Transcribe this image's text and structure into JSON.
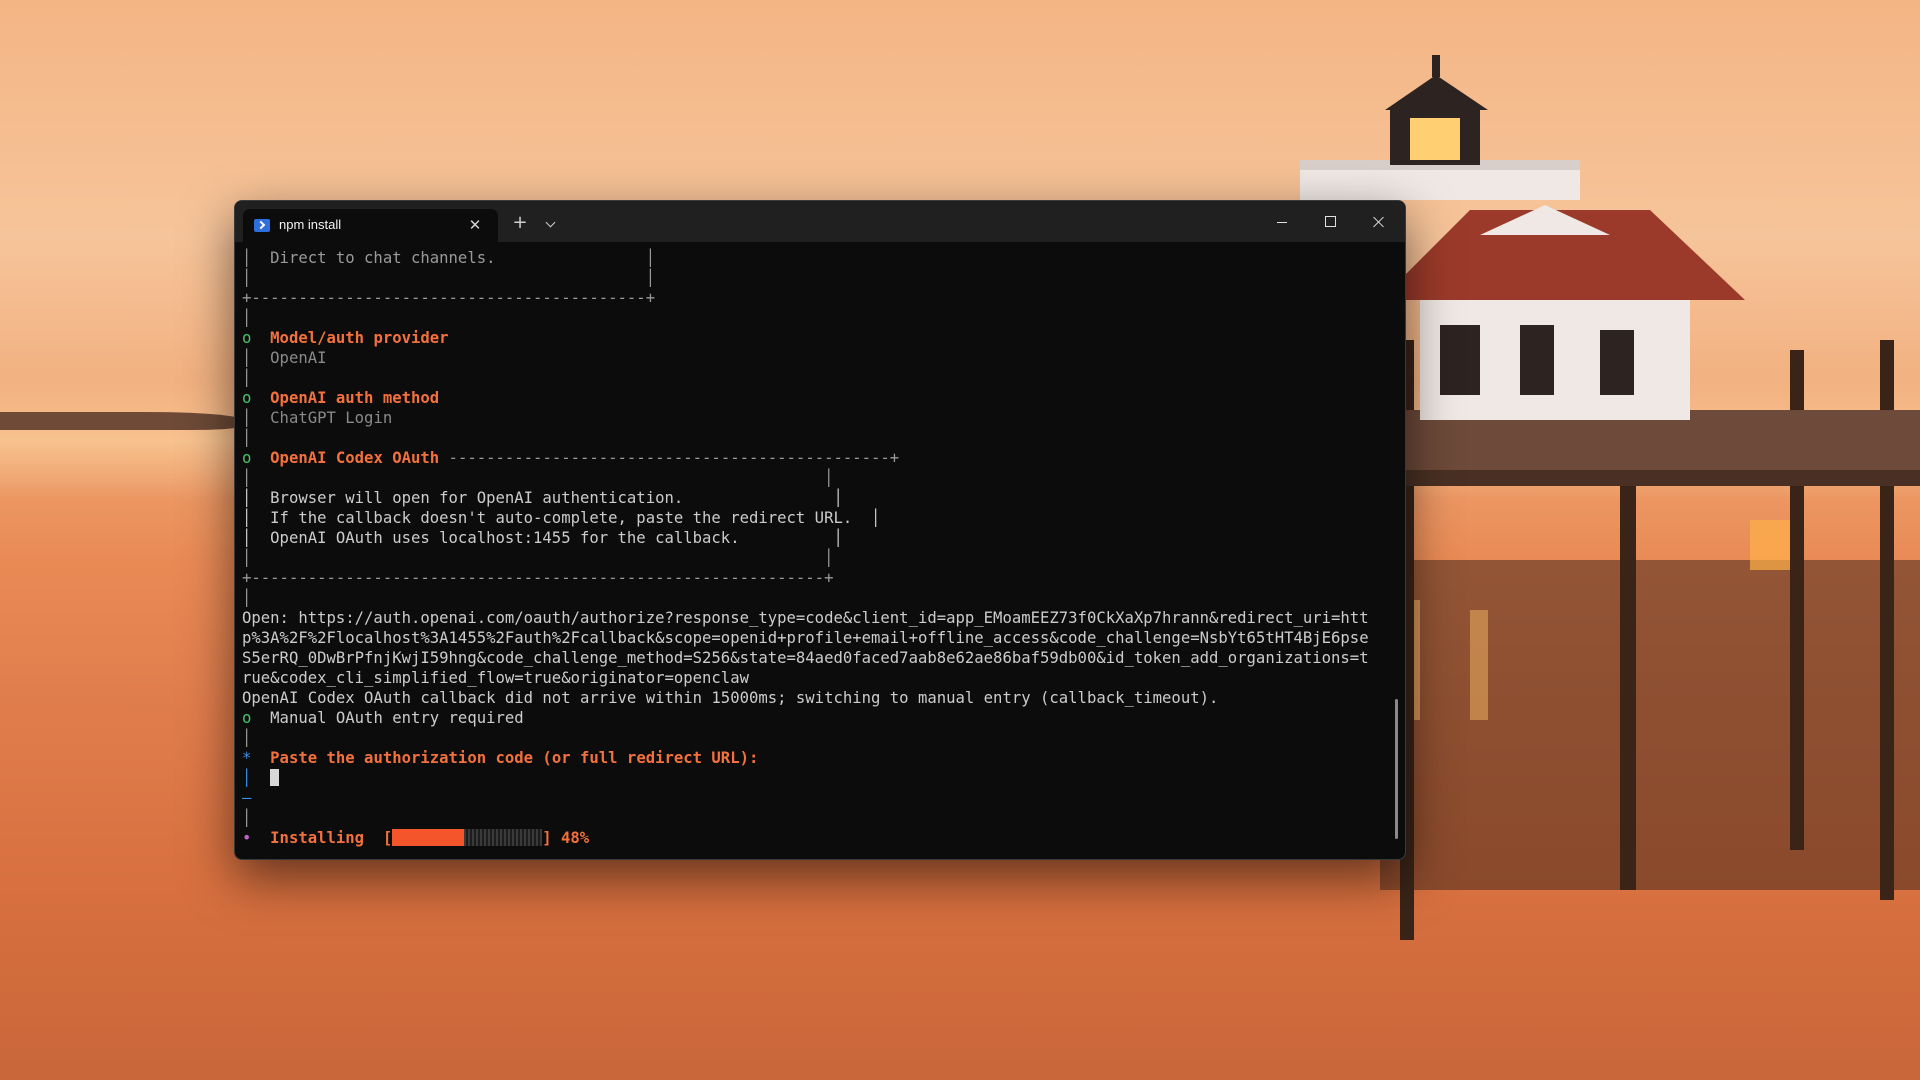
{
  "tab": {
    "title": "npm install",
    "icon": "powershell-icon"
  },
  "titlebar": {
    "new_tab": "+",
    "close_tab": "✕"
  },
  "lines": [
    "│  Direct to chat channels.                │",
    "│                                          │",
    "+------------------------------------------+",
    "│",
    "Model/auth provider",
    "OpenAI",
    "│",
    "OpenAI auth method",
    "ChatGPT Login",
    "│",
    "OpenAI Codex OAuth",
    " -----------------------------------------------+",
    "│                                                             │",
    "│  Browser will open for OpenAI authentication.                │",
    "│  If the callback doesn't auto-complete, paste the redirect URL.  │",
    "│  OpenAI OAuth uses localhost:1455 for the callback.          │",
    "│                                                             │",
    "+-------------------------------------------------------------+",
    "│",
    "Open: https://auth.openai.com/oauth/authorize?response_type=code&client_id=app_EMoamEEZ73f0CkXaXp7hrann&redirect_uri=htt",
    "p%3A%2F%2Flocalhost%3A1455%2Fauth%2Fcallback&scope=openid+profile+email+offline_access&code_challenge=NsbYt65tHT4BjE6pse",
    "S5erRQ_0DwBrPfnjKwjI59hng&code_challenge_method=S256&state=84aed0faced7aab8e62ae86baf59db00&id_token_add_organizations=t",
    "rue&codex_cli_simplified_flow=true&originator=openclaw",
    "OpenAI Codex OAuth callback did not arrive within 15000ms; switching to manual entry (callback_timeout).",
    "Manual OAuth entry required",
    "│",
    "Paste the authorization code (or full redirect URL):",
    "│",
    "—",
    "│",
    "Installing"
  ],
  "markers": {
    "done": "o",
    "active": "*",
    "bar": "│",
    "pipe_blue": "│",
    "dash_blue": "—",
    "spinner": "•"
  },
  "progress": {
    "percent": 48,
    "label": "48%",
    "open_bracket": "[",
    "close_bracket": "]"
  },
  "colors": {
    "success_marker": "#4ac26b",
    "heading_orange": "#f4703c",
    "prompt_blue": "#3b8eea",
    "spinner_purple": "#c061cb",
    "progress_fill": "#f4552a",
    "terminal_bg": "#0c0c0c"
  }
}
